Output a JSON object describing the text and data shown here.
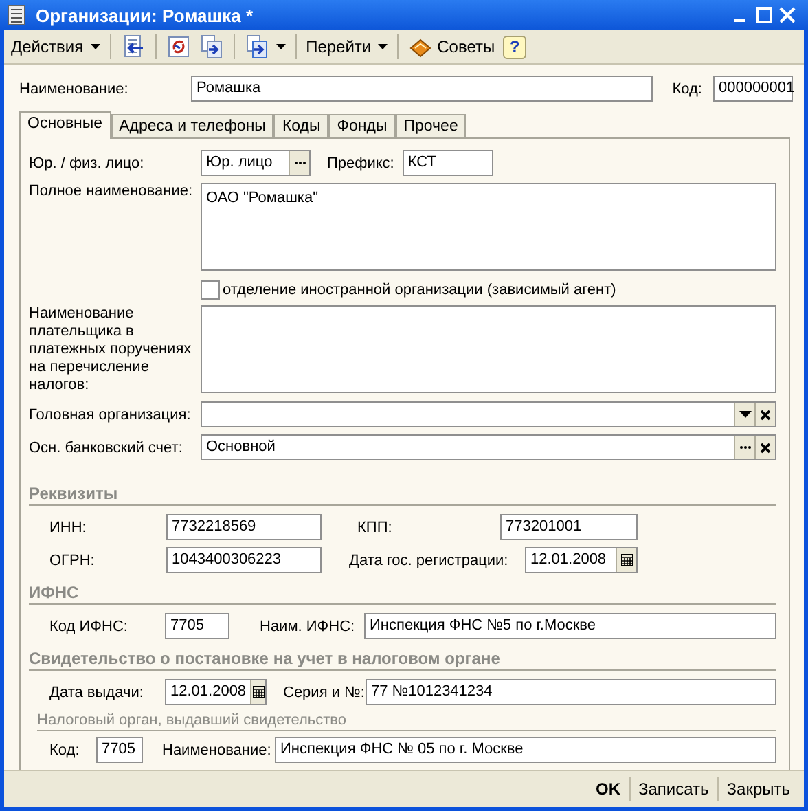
{
  "window": {
    "title": "Организации: Ромашка *"
  },
  "toolbar": [
    {
      "items": [
        {
          "kind": "menu",
          "label": "Действия"
        }
      ]
    },
    {
      "items": [
        {
          "kind": "back"
        }
      ]
    },
    {
      "items": [
        {
          "kind": "refresh"
        },
        {
          "kind": "copy"
        }
      ]
    },
    {
      "items": [
        {
          "kind": "copymenu"
        }
      ]
    },
    {
      "items": [
        {
          "kind": "menu",
          "label": "Перейти"
        }
      ]
    },
    {
      "items": [
        {
          "kind": "advice",
          "label": "Советы"
        },
        {
          "kind": "help",
          "label": "?"
        }
      ]
    }
  ],
  "name": {
    "label": "Наименование:",
    "value": "Ромашка"
  },
  "code": {
    "label": "Код:",
    "value": "000000001"
  },
  "tabs": [
    {
      "label": "Основные",
      "selected": true
    },
    {
      "label": "Адреса и телефоны",
      "selected": false
    },
    {
      "label": "Коды",
      "selected": false
    },
    {
      "label": "Фонды",
      "selected": false
    },
    {
      "label": "Прочее",
      "selected": false
    }
  ],
  "main": {
    "legal_type": {
      "label": "Юр. / физ. лицо:",
      "value": "Юр. лицо"
    },
    "prefix": {
      "label": "Префикс:",
      "value": "КСТ"
    },
    "full_name": {
      "label": "Полное наименование:",
      "value": "ОАО \"Ромашка\""
    },
    "foreign_branch": {
      "label": "отделение иностранной организации (зависимый агент)",
      "checked": false
    },
    "payer_name": {
      "label": "Наименование плательщика в платежных поручениях на перечисление налогов:"
    },
    "head_org": {
      "label": "Головная организация:"
    },
    "bank_account": {
      "label": "Осн. банковский счет:",
      "value": "Основной"
    }
  },
  "requisites": {
    "title": "Реквизиты",
    "inn": {
      "label": "ИНН:",
      "value": "7732218569"
    },
    "kpp": {
      "label": "КПП:",
      "value": "773201001"
    },
    "ogrn": {
      "label": "ОГРН:",
      "value": "1043400306223"
    },
    "reg_date": {
      "label": "Дата гос. регистрации:",
      "value": "12.01.2008"
    }
  },
  "ifns": {
    "title": "ИФНС",
    "code": {
      "label": "Код ИФНС:",
      "value": "7705"
    },
    "name": {
      "label": "Наим. ИФНС:",
      "value": "Инспекция ФНС №5 по г.Москве"
    }
  },
  "certificate": {
    "title": "Свидетельство о постановке на учет в налоговом органе",
    "issue_date": {
      "label": "Дата выдачи:",
      "value": "12.01.2008"
    },
    "series": {
      "label": "Серия и №:",
      "value": "77 №1012341234"
    },
    "authority_title": "Налоговый орган, выдавший свидетельство",
    "code": {
      "label": "Код:",
      "value": "7705"
    },
    "name": {
      "label": "Наименование:",
      "value": "Инспекция ФНС № 05 по г. Москве"
    }
  },
  "buttons": [
    {
      "label": "OK",
      "default": true
    },
    {
      "label": "Записать",
      "default": false
    },
    {
      "label": "Закрыть",
      "default": false
    }
  ]
}
